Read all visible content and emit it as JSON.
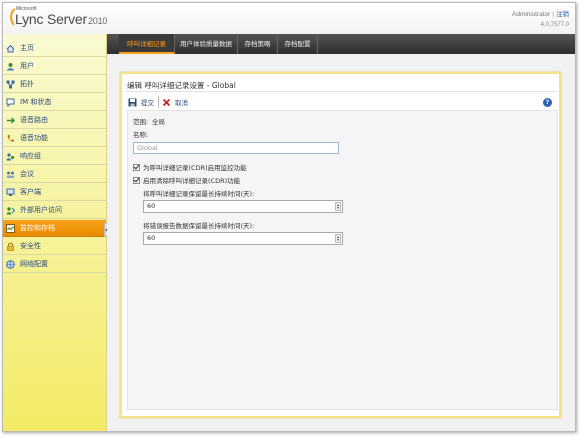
{
  "header": {
    "brand_small": "Microsoft",
    "brand_name": "Lync Server",
    "brand_year": "2010",
    "user": "Administrator",
    "separator": "|",
    "logout_label": "注销",
    "version": "4.0.7577.0"
  },
  "sidebar": {
    "items": [
      {
        "label": "主页",
        "icon": "home-icon",
        "active": false
      },
      {
        "label": "用户",
        "icon": "users-icon",
        "active": false
      },
      {
        "label": "拓扑",
        "icon": "topology-icon",
        "active": false
      },
      {
        "label": "IM 和状态",
        "icon": "im-presence-icon",
        "active": false
      },
      {
        "label": "语音路由",
        "icon": "voice-routing-icon",
        "active": false
      },
      {
        "label": "语音功能",
        "icon": "phone-icon",
        "active": false
      },
      {
        "label": "响应组",
        "icon": "response-group-icon",
        "active": false
      },
      {
        "label": "会议",
        "icon": "conferencing-icon",
        "active": false
      },
      {
        "label": "客户端",
        "icon": "clients-icon",
        "active": false
      },
      {
        "label": "外部用户访问",
        "icon": "external-access-icon",
        "active": false
      },
      {
        "label": "监控和存档",
        "icon": "monitoring-icon",
        "active": true
      },
      {
        "label": "安全性",
        "icon": "lock-icon",
        "active": false
      },
      {
        "label": "网络配置",
        "icon": "network-icon",
        "active": false
      }
    ]
  },
  "tabs": [
    {
      "label": "呼叫详细记录",
      "active": true
    },
    {
      "label": "用户体验质量数据",
      "active": false
    },
    {
      "label": "存档策略",
      "active": false
    },
    {
      "label": "存档配置",
      "active": false
    }
  ],
  "panel": {
    "title": "编辑 呼叫详细记录设置 - Global",
    "commit_label": "提交",
    "cancel_label": "取消",
    "help_label": "?",
    "scope_label": "范围:",
    "scope_value": "全局",
    "name_label": "名称:",
    "name_value": "Global",
    "cdr_checkbox_label": "为呼叫详细记录(CDR)启用监控功能",
    "cdr_checked": true,
    "purge_checkbox_label": "启用清除呼叫详细记录(CDR)功能",
    "purge_checked": true,
    "cdr_days_label": "将呼叫详细记录保留最长持续时间(天):",
    "cdr_days_value": "60",
    "error_days_label": "将错误报告数据保留最长持续时间(天):",
    "error_days_value": "60"
  },
  "colors": {
    "accent": "#f7a21a",
    "sidebar_bg": "#f6f3a0",
    "tabbar_bg": "#3a3a3a",
    "link": "#2a62a8"
  }
}
